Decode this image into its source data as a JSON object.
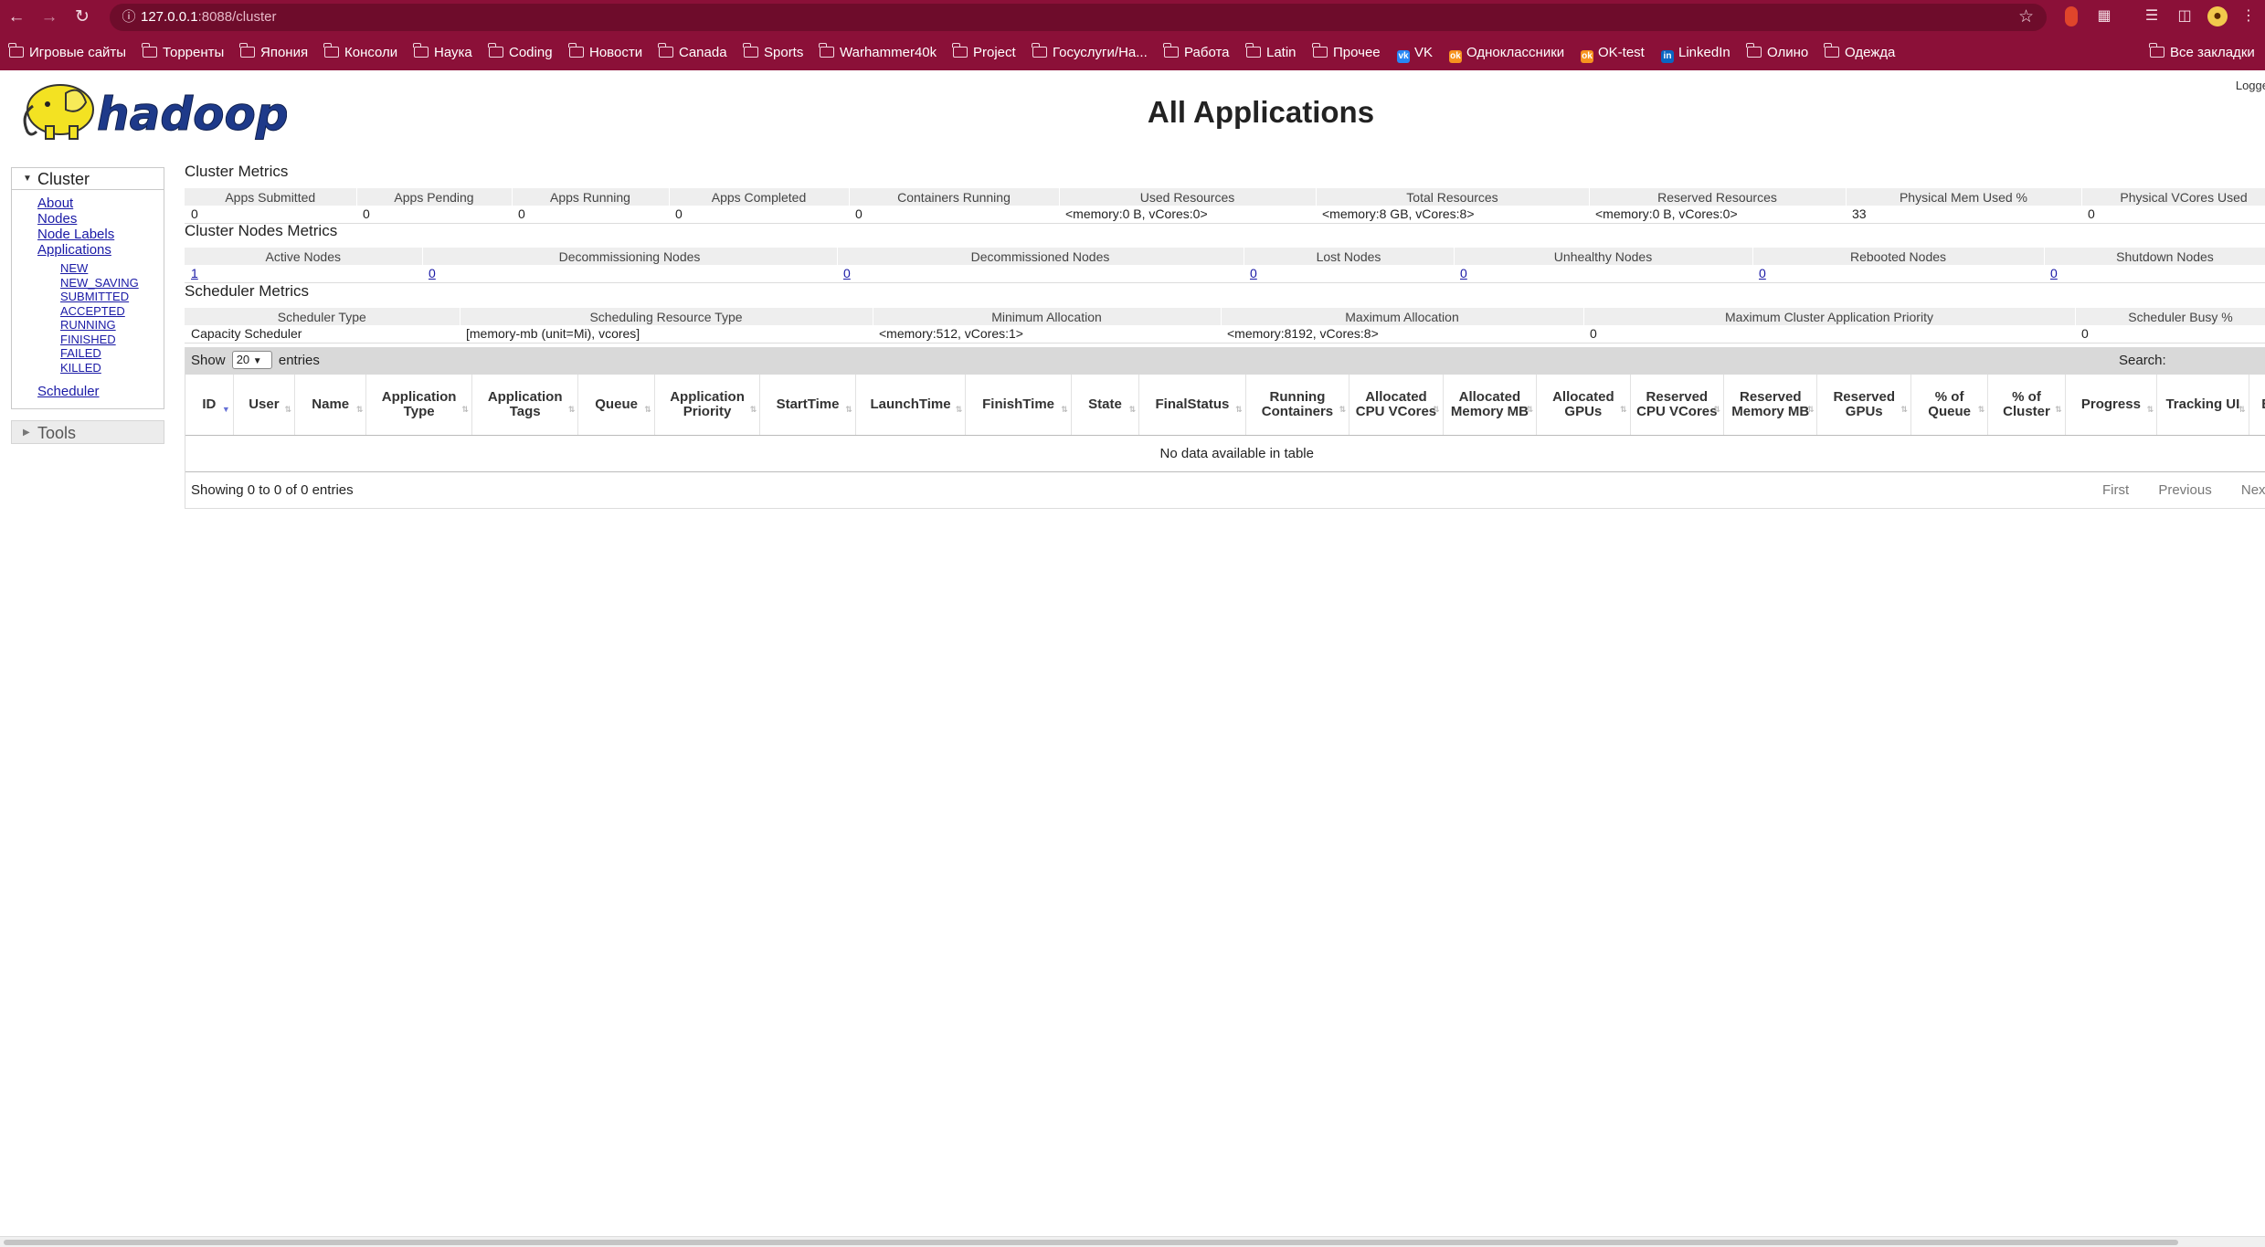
{
  "browser": {
    "url_host": "127.0.0.1",
    "url_path": ":8088/cluster",
    "bookmarks": [
      {
        "label": "Игровые сайты",
        "kind": "folder"
      },
      {
        "label": "Торренты",
        "kind": "folder"
      },
      {
        "label": "Япония",
        "kind": "folder"
      },
      {
        "label": "Консоли",
        "kind": "folder"
      },
      {
        "label": "Наука",
        "kind": "folder"
      },
      {
        "label": "Coding",
        "kind": "folder"
      },
      {
        "label": "Новости",
        "kind": "folder"
      },
      {
        "label": "Canada",
        "kind": "folder"
      },
      {
        "label": "Sports",
        "kind": "folder"
      },
      {
        "label": "Warhammer40k",
        "kind": "folder"
      },
      {
        "label": "Project",
        "kind": "folder"
      },
      {
        "label": "Госуслуги/На...",
        "kind": "folder"
      },
      {
        "label": "Работа",
        "kind": "folder"
      },
      {
        "label": "Latin",
        "kind": "folder"
      },
      {
        "label": "Прочее",
        "kind": "folder"
      },
      {
        "label": "VK",
        "kind": "site",
        "color": "#2787f5",
        "glyph": "vk"
      },
      {
        "label": "Одноклассники",
        "kind": "site",
        "color": "#f7931e",
        "glyph": "ok"
      },
      {
        "label": "OK-test",
        "kind": "site",
        "color": "#f7931e",
        "glyph": "ok"
      },
      {
        "label": "LinkedIn",
        "kind": "site",
        "color": "#0a66c2",
        "glyph": "in"
      },
      {
        "label": "Олино",
        "kind": "folder"
      },
      {
        "label": "Одежда",
        "kind": "folder"
      }
    ],
    "all_bookmarks_label": "Все закладки"
  },
  "header": {
    "logo_text": "hadoop",
    "title": "All Applications",
    "logged_text": "Logge"
  },
  "sidebar": {
    "cluster_label": "Cluster",
    "links": [
      "About",
      "Nodes",
      "Node Labels",
      "Applications"
    ],
    "app_states": [
      "NEW",
      "NEW_SAVING",
      "SUBMITTED",
      "ACCEPTED",
      "RUNNING",
      "FINISHED",
      "FAILED",
      "KILLED"
    ],
    "scheduler_label": "Scheduler",
    "tools_label": "Tools"
  },
  "cluster_metrics": {
    "title": "Cluster Metrics",
    "headers": [
      "Apps Submitted",
      "Apps Pending",
      "Apps Running",
      "Apps Completed",
      "Containers Running",
      "Used Resources",
      "Total Resources",
      "Reserved Resources",
      "Physical Mem Used %",
      "Physical VCores Used"
    ],
    "values": [
      "0",
      "0",
      "0",
      "0",
      "0",
      "<memory:0 B, vCores:0>",
      "<memory:8 GB, vCores:8>",
      "<memory:0 B, vCores:0>",
      "33",
      "0"
    ]
  },
  "nodes_metrics": {
    "title": "Cluster Nodes Metrics",
    "headers": [
      "Active Nodes",
      "Decommissioning Nodes",
      "Decommissioned Nodes",
      "Lost Nodes",
      "Unhealthy Nodes",
      "Rebooted Nodes",
      "Shutdown Nodes"
    ],
    "values": [
      "1",
      "0",
      "0",
      "0",
      "0",
      "0",
      "0"
    ]
  },
  "scheduler_metrics": {
    "title": "Scheduler Metrics",
    "headers": [
      "Scheduler Type",
      "Scheduling Resource Type",
      "Minimum Allocation",
      "Maximum Allocation",
      "Maximum Cluster Application Priority",
      "Scheduler Busy %"
    ],
    "values": [
      "Capacity Scheduler",
      "[memory-mb (unit=Mi), vcores]",
      "<memory:512, vCores:1>",
      "<memory:8192, vCores:8>",
      "0",
      "0"
    ]
  },
  "apps_table": {
    "show_label": "Show",
    "entries_value": "20",
    "entries_label": "entries",
    "search_label": "Search:",
    "columns": [
      "ID",
      "User",
      "Name",
      "Application Type",
      "Application Tags",
      "Queue",
      "Application Priority",
      "StartTime",
      "LaunchTime",
      "FinishTime",
      "State",
      "FinalStatus",
      "Running Containers",
      "Allocated CPU VCores",
      "Allocated Memory MB",
      "Allocated GPUs",
      "Reserved CPU VCores",
      "Reserved Memory MB",
      "Reserved GPUs",
      "% of Queue",
      "% of Cluster",
      "Progress",
      "Tracking UI",
      "Bl"
    ],
    "empty_message": "No data available in table",
    "info": "Showing 0 to 0 of 0 entries",
    "paging": [
      "First",
      "Previous",
      "Next"
    ]
  }
}
